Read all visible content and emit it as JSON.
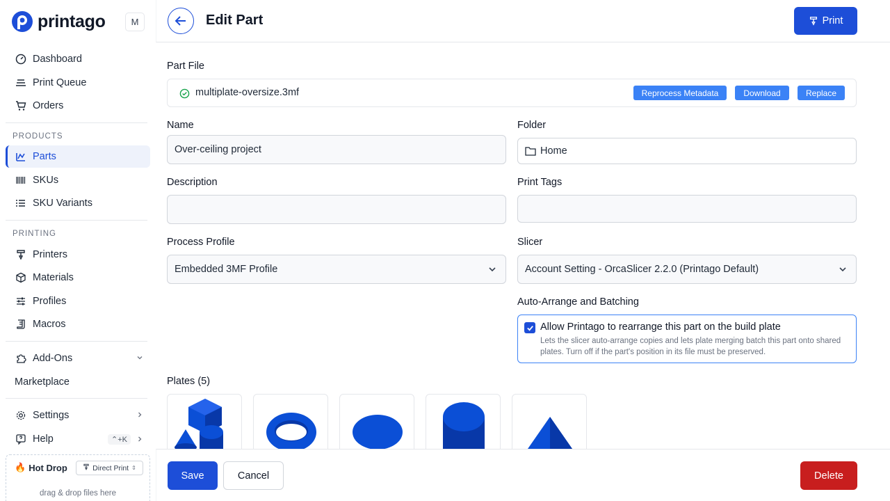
{
  "app": {
    "name": "printago",
    "org_initial": "M"
  },
  "sidebar": {
    "items_top": [
      {
        "label": "Dashboard",
        "icon": "gauge-icon"
      },
      {
        "label": "Print Queue",
        "icon": "queue-icon"
      },
      {
        "label": "Orders",
        "icon": "cart-icon"
      }
    ],
    "products_label": "PRODUCTS",
    "products": [
      {
        "label": "Parts",
        "icon": "parts-icon",
        "active": true
      },
      {
        "label": "SKUs",
        "icon": "barcode-icon"
      },
      {
        "label": "SKU Variants",
        "icon": "list-icon"
      }
    ],
    "printing_label": "PRINTING",
    "printing": [
      {
        "label": "Printers",
        "icon": "printer-icon"
      },
      {
        "label": "Materials",
        "icon": "cube-icon"
      },
      {
        "label": "Profiles",
        "icon": "sliders-icon"
      },
      {
        "label": "Macros",
        "icon": "script-icon"
      }
    ],
    "addons": {
      "label": "Add-Ons",
      "icon": "puzzle-icon"
    },
    "marketplace": {
      "label": "Marketplace"
    },
    "settings": {
      "label": "Settings",
      "icon": "gear-icon"
    },
    "help": {
      "label": "Help",
      "icon": "help-icon",
      "shortcut": "⌃+K"
    },
    "hotdrop": {
      "title": "Hot Drop",
      "mode": "Direct Print",
      "hint": "drag & drop files here"
    }
  },
  "header": {
    "title": "Edit Part",
    "print_label": "Print"
  },
  "form": {
    "part_file_label": "Part File",
    "file_name": "multiplate-oversize.3mf",
    "reprocess_label": "Reprocess Metadata",
    "download_label": "Download",
    "replace_label": "Replace",
    "name_label": "Name",
    "name_value": "Over-ceiling project",
    "folder_label": "Folder",
    "folder_value": "Home",
    "description_label": "Description",
    "description_value": "",
    "tags_label": "Print Tags",
    "tags_value": "",
    "process_label": "Process Profile",
    "process_value": "Embedded 3MF Profile",
    "slicer_label": "Slicer",
    "slicer_value": "Account Setting - OrcaSlicer 2.2.0 (Printago Default)",
    "auto_label": "Auto-Arrange and Batching",
    "auto_title": "Allow Printago to rearrange this part on the build plate",
    "auto_desc": "Lets the slicer auto-arrange copies and lets plate merging batch this part onto shared plates. Turn off if the part's position in its file must be preserved.",
    "auto_checked": true,
    "plates_label": "Plates (5)"
  },
  "footer": {
    "save_label": "Save",
    "cancel_label": "Cancel",
    "delete_label": "Delete"
  },
  "colors": {
    "brand": "#1d4ed8",
    "accent": "#3b82f6",
    "danger": "#c81e1e",
    "model": "#0b4fd6"
  }
}
